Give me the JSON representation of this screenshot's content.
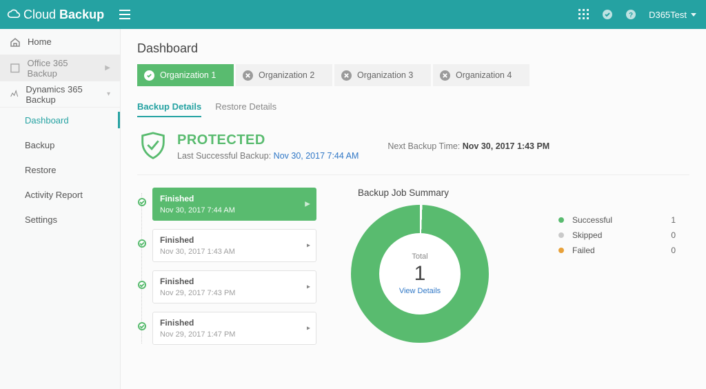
{
  "header": {
    "product_name_light": "Cloud",
    "product_name_bold": "Backup",
    "user_label": "D365Test"
  },
  "sidebar": {
    "home": "Home",
    "office365": "Office 365 Backup",
    "dynamics365": "Dynamics 365 Backup",
    "sub": {
      "dashboard": "Dashboard",
      "backup": "Backup",
      "restore": "Restore",
      "activity_report": "Activity Report",
      "settings": "Settings"
    }
  },
  "page": {
    "title": "Dashboard",
    "org_tabs": [
      "Organization 1",
      "Organization 2",
      "Organization 3",
      "Organization 4"
    ],
    "sub_tabs": {
      "backup_details": "Backup Details",
      "restore_details": "Restore Details"
    },
    "protected": {
      "title": "PROTECTED",
      "last_label": "Last Successful Backup:",
      "last_value": "Nov 30, 2017 7:44 AM",
      "next_label": "Next Backup Time:",
      "next_value": "Nov 30, 2017 1:43 PM"
    },
    "timeline": [
      {
        "status": "Finished",
        "time": "Nov 30, 2017 7:44 AM",
        "active": true
      },
      {
        "status": "Finished",
        "time": "Nov 30, 2017 1:43 AM",
        "active": false
      },
      {
        "status": "Finished",
        "time": "Nov 29, 2017 7:43 PM",
        "active": false
      },
      {
        "status": "Finished",
        "time": "Nov 29, 2017 1:47 PM",
        "active": false
      }
    ],
    "summary": {
      "title": "Backup Job Summary",
      "total_label": "Total",
      "total_value": "1",
      "view_details": "View Details",
      "legend": {
        "successful": {
          "label": "Successful",
          "value": "1",
          "color": "#59bb6f"
        },
        "skipped": {
          "label": "Skipped",
          "value": "0",
          "color": "#c9c9c9"
        },
        "failed": {
          "label": "Failed",
          "value": "0",
          "color": "#e8a13a"
        }
      }
    }
  }
}
